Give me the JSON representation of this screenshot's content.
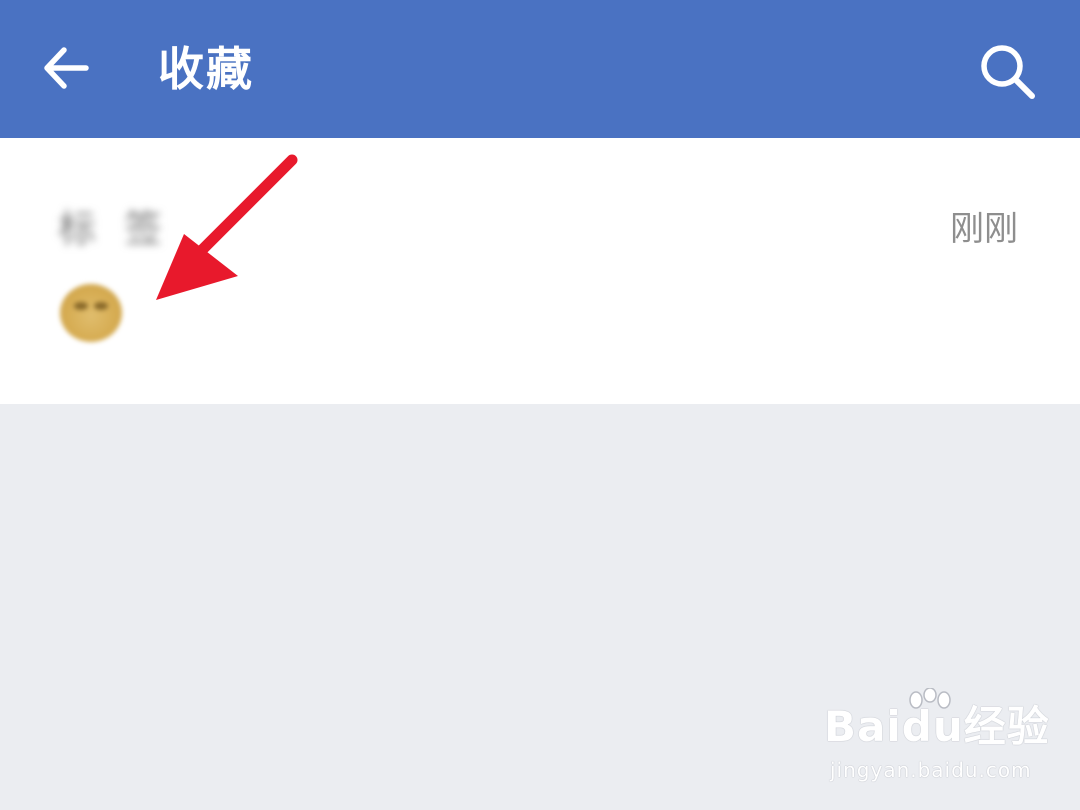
{
  "app_bar": {
    "title": "收藏",
    "background": "#4a72c2",
    "back_icon": "arrow-left-icon",
    "search_icon": "search-icon"
  },
  "favorites": {
    "items": [
      {
        "sender": "标 签",
        "time": "刚刚",
        "content_icon": "grinning-emoji-icon"
      }
    ]
  },
  "annotation": {
    "icon": "red-arrow-pointer",
    "color": "#e8192c"
  },
  "watermark": {
    "brand": "Baidu经验",
    "url": "jingyan.baidu.com"
  }
}
